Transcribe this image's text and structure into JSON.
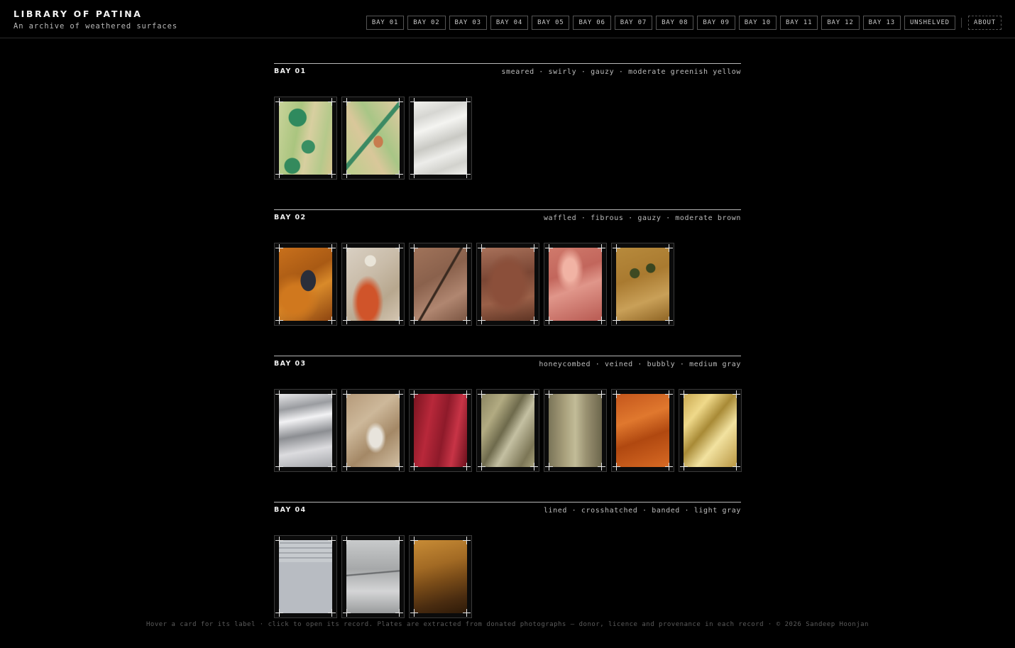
{
  "site": {
    "title": "LIBRARY OF PATINA",
    "subtitle": "An archive of weathered surfaces"
  },
  "nav": {
    "bays": [
      "BAY 01",
      "BAY 02",
      "BAY 03",
      "BAY 04",
      "BAY 05",
      "BAY 06",
      "BAY 07",
      "BAY 08",
      "BAY 09",
      "BAY 10",
      "BAY 11",
      "BAY 12",
      "BAY 13"
    ],
    "unshelved": "UNSHELVED",
    "about": "ABOUT"
  },
  "bays": [
    {
      "title": "BAY 01",
      "tags": "smeared · swirly · gauzy · moderate greenish yellow",
      "plates": [
        "radial-gradient(circle at 35% 22%, #2f8a5e 0 13%, transparent 14%), radial-gradient(circle at 55% 62%, #3a8f63 0 12%, transparent 13%), radial-gradient(circle at 25% 88%, #348a5d 0 10%, transparent 11%), linear-gradient(100deg, #c9d39a 0%, #aac57f 35%, #d8cfa0 55%, #b5c98b 80%, #d6c48e 100%)",
        "radial-gradient(ellipse at 60% 55%, #c77c4f 0 10%, transparent 11%), linear-gradient(130deg, transparent 45%, #3c8a63 46% 50%, transparent 51%), linear-gradient(60deg, #b9cf8c 0%, #d9c79a 40%, #a8c686 60%, #e2caa2 100%)",
        "linear-gradient(160deg, #f2f2ee 0%, #d6d6d2 20%, #f4f4f1 35%, #c9c9c4 55%, #ededea 70%, #d2d2cd 85%, #f0f0ec 100%)"
      ]
    },
    {
      "title": "BAY 02",
      "tags": "waffled · fibrous · gauzy · moderate brown",
      "plates": [
        "radial-gradient(ellipse at 55% 45%, #2a2e3a 0 18%, transparent 19%), radial-gradient(circle at 30% 70%, #d0781e 0 20%, transparent 40%), linear-gradient(150deg, #c8701c 0%, #a95a14 40%, #d98a2a 60%, #8c4410 100%)",
        "radial-gradient(circle at 45% 18%, #e9e4d8 0 8%, transparent 9%), radial-gradient(ellipse at 40% 75%, #d0542a 0 22%, transparent 35%), linear-gradient(140deg, #d9d0c3 0%, #c9bca9 40%, #b7a78e 70%, #d4c6b2 100%)",
        "linear-gradient(120deg, transparent 48%, #3a2a20 49% 51%, transparent 52%), linear-gradient(150deg, #a0735a 0%, #8a614c 40%, #b08670 70%, #7b5542 100%)",
        "radial-gradient(ellipse at 50% 50%, #8b4f3a 0 40%, transparent 60%), linear-gradient(170deg, #a8715a 0%, #7a4634 40%, #9a6048 70%, #5e3424 100%)",
        "radial-gradient(ellipse at 40% 30%, #f1b3a4 0 15%, transparent 30%), linear-gradient(160deg, #d07a6c 0%, #c2665c 35%, #e0968a 55%, #b85a52 100%)",
        "radial-gradient(circle at 35% 35%, #3f4a22 0 8%, transparent 9%), radial-gradient(circle at 65% 28%, #3a4620 0 7%, transparent 8%), linear-gradient(160deg, #b78a3c 0%, #a97a30 40%, #c9a058 70%, #8e6424 100%)"
      ]
    },
    {
      "title": "BAY 03",
      "tags": "honeycombed · veined · bubbly · medium gray",
      "plates": [
        "linear-gradient(170deg, #e8e8ea 0%, #9a9ca0 20%, #f2f2f4 35%, #8c8e92 55%, #dcdcdf 75%, #a4a6aa 100%)",
        "radial-gradient(ellipse at 55% 60%, #e8e4dc 0 15%, transparent 25%), linear-gradient(140deg, #b59a7a 0%, #cdb89a 35%, #a48866 65%, #d2c0a4 100%)",
        "linear-gradient(100deg, #7a1420 0%, #b8283a 30%, #8e1a2a 55%, #c83446 75%, #6a101c 100%)",
        "linear-gradient(120deg, #8a8460 0%, #b2ab82 25%, #6e6a4c 45%, #c4c0a2 60%, #7c7656 85%, #a8a27c 100%)",
        "linear-gradient(90deg, #7a7458 0%, #a8a07c 30%, #c2bc98 50%, #9a9272 70%, #6c664c 100%)",
        "linear-gradient(160deg, #c4561c 0%, #e0782e 35%, #b04810 60%, #d86a24 100%)",
        "linear-gradient(130deg, #c9a850 0%, #efd98a 25%, #a88a36 45%, #f2e2a0 65%, #b89642 100%)"
      ]
    },
    {
      "title": "BAY 04",
      "tags": "lined · crosshatched · banded · light gray",
      "plates": [
        "linear-gradient(180deg, transparent 0 30%, #b8bcc2 30%), repeating-linear-gradient(0deg, #a4a8ae 0 2px, #c6cace 2px 7px), linear-gradient(90deg, #7c8086 0%, #c0c4c8 50%, #8a8e94 100%)",
        "linear-gradient(175deg, transparent 0 44%, #6a6c6e 45% 46%, transparent 47%), linear-gradient(180deg, #c8cacb 0%, #a6a8a9 40%, #d4d5d6 70%, #9a9c9d 100%)",
        "linear-gradient(165deg, #c88c36 0%, #a26a24 35%, #7a4c18 55%, #4a2c10 80%, #2e1a08 100%)"
      ]
    }
  ],
  "footer": "Hover a card for its label · click to open its record. Plates are extracted from donated photographs — donor, licence and provenance in each record · © 2026 Sandeep Hoonjan"
}
